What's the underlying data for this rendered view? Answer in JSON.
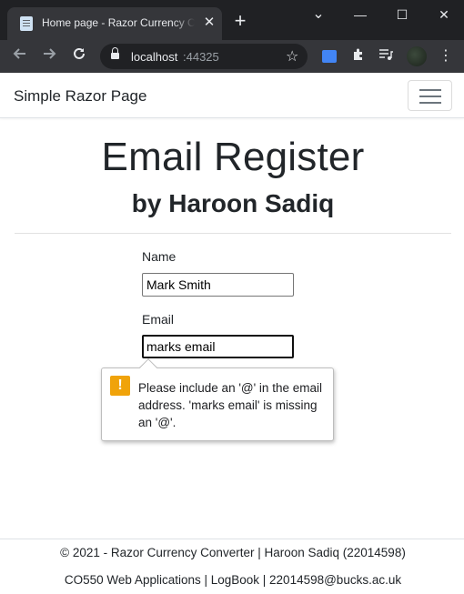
{
  "browser": {
    "tab_title": "Home page - Razor Currency Converter",
    "tab_close": "✕",
    "new_tab": "+",
    "url_host": "localhost",
    "url_port": ":44325",
    "window_controls": {
      "minimize": "—",
      "maximize": "☐",
      "close": "✕",
      "dropdown": "⌄"
    }
  },
  "navbar": {
    "brand": "Simple Razor Page"
  },
  "hero": {
    "title": "Email Register",
    "subtitle": "by Haroon Sadiq"
  },
  "form": {
    "name_label": "Name",
    "name_value": "Mark Smith",
    "email_label": "Email",
    "email_value": "marks email"
  },
  "validation": {
    "message": "Please include an '@' in the email address. 'marks email' is missing an '@'.",
    "icon": "!",
    "icon_color": "#f0a30a"
  },
  "footer": {
    "line1": "© 2021 - Razor Currency Converter | Haroon Sadiq (22014598)",
    "line2": "CO550 Web Applications | LogBook | 22014598@bucks.ac.uk"
  }
}
